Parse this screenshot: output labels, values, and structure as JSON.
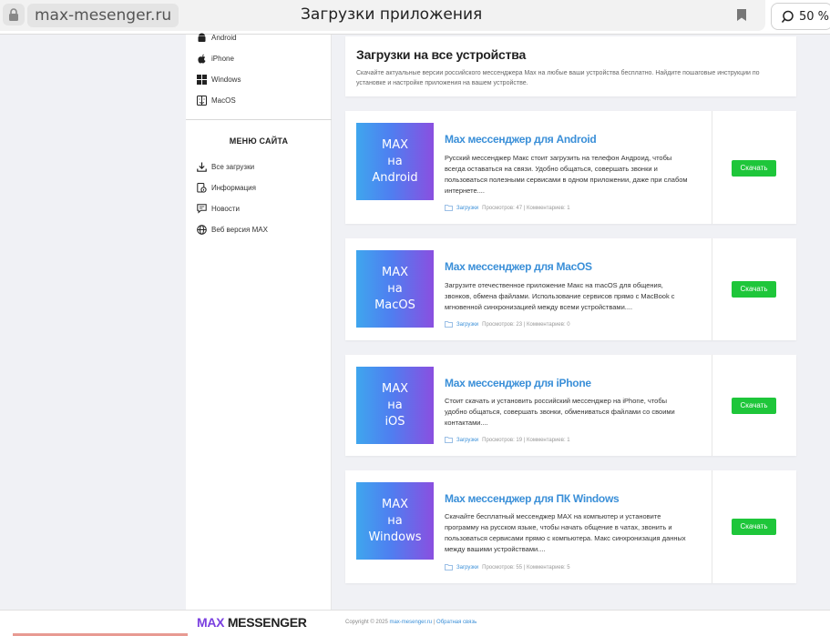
{
  "browser": {
    "url": "max-mesenger.ru",
    "page_title": "Загрузки приложения",
    "zoom": "50 %"
  },
  "sidebar": {
    "platforms": [
      {
        "label": "Android",
        "icon": "android-icon"
      },
      {
        "label": "iPhone",
        "icon": "apple-icon"
      },
      {
        "label": "Windows",
        "icon": "windows-icon"
      },
      {
        "label": "MacOS",
        "icon": "finder-icon"
      }
    ],
    "menu_title": "МЕНЮ САЙТА",
    "menu": [
      {
        "label": "Все загрузки",
        "icon": "download-icon"
      },
      {
        "label": "Информация",
        "icon": "info-doc-icon"
      },
      {
        "label": "Новости",
        "icon": "chat-icon"
      },
      {
        "label": "Веб версия MAX",
        "icon": "globe-icon"
      }
    ]
  },
  "hero": {
    "title": "Загрузки на все устройства",
    "text": "Скачайте актуальные версии российского мессенджера Max на любые ваши устройства бесплатно. Найдите пошаговые инструкции по установке и настройке приложения на вашем устройстве."
  },
  "cards": [
    {
      "thumb": [
        "MAX",
        "на",
        "Android"
      ],
      "title": "Max мессенджер для Android",
      "desc": "Русский мессенджер Макс стоит загрузить на телефон Андроид, чтобы всегда оставаться на связи. Удобно общаться, совершать звонки и пользоваться полезными сервисами в одном приложении, даже при слабом интернете....",
      "category": "Загрузки",
      "stats": "Просмотров: 47 | Комментариев: 1",
      "button": "Скачать"
    },
    {
      "thumb": [
        "MAX",
        "на",
        "MacOS"
      ],
      "title": "Max мессенджер для MacOS",
      "desc": "Загрузите отечественное приложение Макс на macOS для общения, звонков, обмена файлами. Использование сервисов прямо с MacBook с мгновенной синхронизацией между всеми устройствами....",
      "category": "Загрузки",
      "stats": "Просмотров: 23 | Комментариев: 0",
      "button": "Скачать"
    },
    {
      "thumb": [
        "MAX",
        "на",
        "iOS"
      ],
      "title": "Max мессенджер для iPhone",
      "desc": "Стоит скачать и установить российский мессенджер на iPhone, чтобы удобно общаться, совершать звонки, обмениваться файлами со своими контактами....",
      "category": "Загрузки",
      "stats": "Просмотров: 19 | Комментариев: 1",
      "button": "Скачать"
    },
    {
      "thumb": [
        "MAX",
        "на",
        "Windows"
      ],
      "title": "Max мессенджер для ПК Windows",
      "desc": "Скачайте бесплатный мессенджер MAX на компьютер и установите программу на русском языке, чтобы начать общение в чатах, звонить и пользоваться сервисами прямо с компьютера. Макс синхронизация данных между вашими устройствами....",
      "category": "Загрузки",
      "stats": "Просмотров: 55 | Комментариев: 5",
      "button": "Скачать"
    }
  ],
  "footer": {
    "logo_max": "MAX",
    "logo_messenger": "MESSENGER",
    "copyright": "Copyright © 2025",
    "site_link": "max-mesenger.ru",
    "separator": "|",
    "feedback": "Обратная связь"
  },
  "colors": {
    "accent_blue": "#3a8fd8",
    "download_green": "#1ec63a",
    "logo_purple": "#7a3fe0"
  }
}
